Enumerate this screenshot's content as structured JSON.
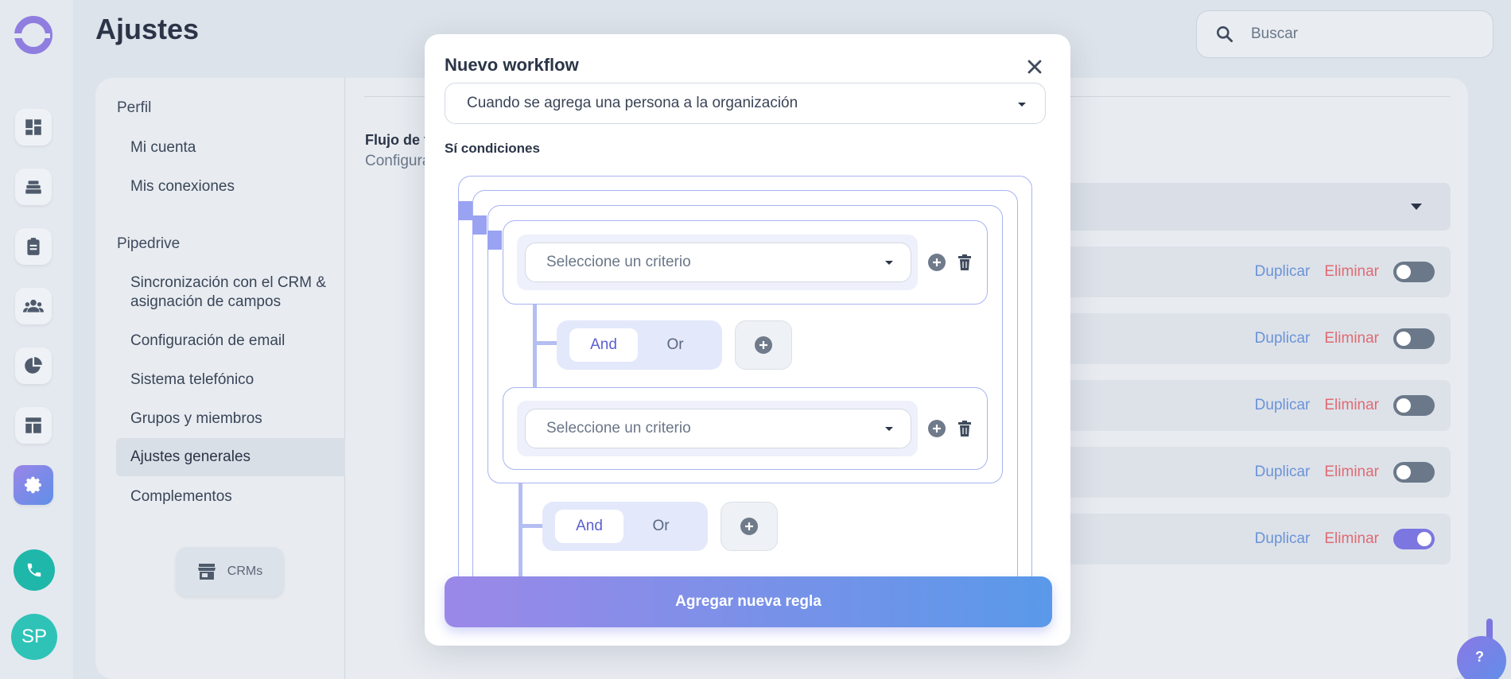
{
  "header": {
    "title": "Ajustes",
    "search_placeholder": "Buscar"
  },
  "rail": {
    "icons": [
      "dashboard-icon",
      "stack-icon",
      "clipboard-icon",
      "people-icon",
      "pie-chart-icon",
      "layout-icon",
      "gear-icon"
    ],
    "avatar_initials": "SP"
  },
  "nav": {
    "section_profile": "Perfil",
    "my_account": "Mi cuenta",
    "my_connections": "Mis conexiones",
    "section_pipedrive": "Pipedrive",
    "crm_sync_line1": "Sincronización con el CRM &",
    "crm_sync_line2": "asignación de campos",
    "email_config": "Configuración de email",
    "phone_system": "Sistema telefónico",
    "groups_members": "Grupos y miembros",
    "general_settings": "Ajustes generales",
    "addons": "Complementos",
    "crms_button": "CRMs"
  },
  "content": {
    "flow_title": "Flujo de t",
    "flow_subtitle": "Configura",
    "rows": [
      {
        "duplicate": "Duplicar",
        "delete": "Eliminar",
        "enabled": false
      },
      {
        "duplicate": "Duplicar",
        "delete": "Eliminar",
        "enabled": false
      },
      {
        "duplicate": "Duplicar",
        "delete": "Eliminar",
        "enabled": false
      },
      {
        "duplicate": "Duplicar",
        "delete": "Eliminar",
        "enabled": false
      },
      {
        "duplicate": "Duplicar",
        "delete": "Eliminar",
        "enabled": true
      }
    ]
  },
  "modal": {
    "title": "Nuevo workflow",
    "trigger_value": "Cuando se agrega una persona a la organización",
    "conditions_label": "Sí condiciones",
    "criterion_placeholder": "Seleccione un criterio",
    "and_label": "And",
    "or_label": "Or",
    "add_rule_label": "Agregar nueva regla"
  },
  "colors": {
    "accent": "#7b76e0",
    "duplicate": "#6b93d8",
    "delete": "#e06a72",
    "phone": "#1fb7aa"
  }
}
